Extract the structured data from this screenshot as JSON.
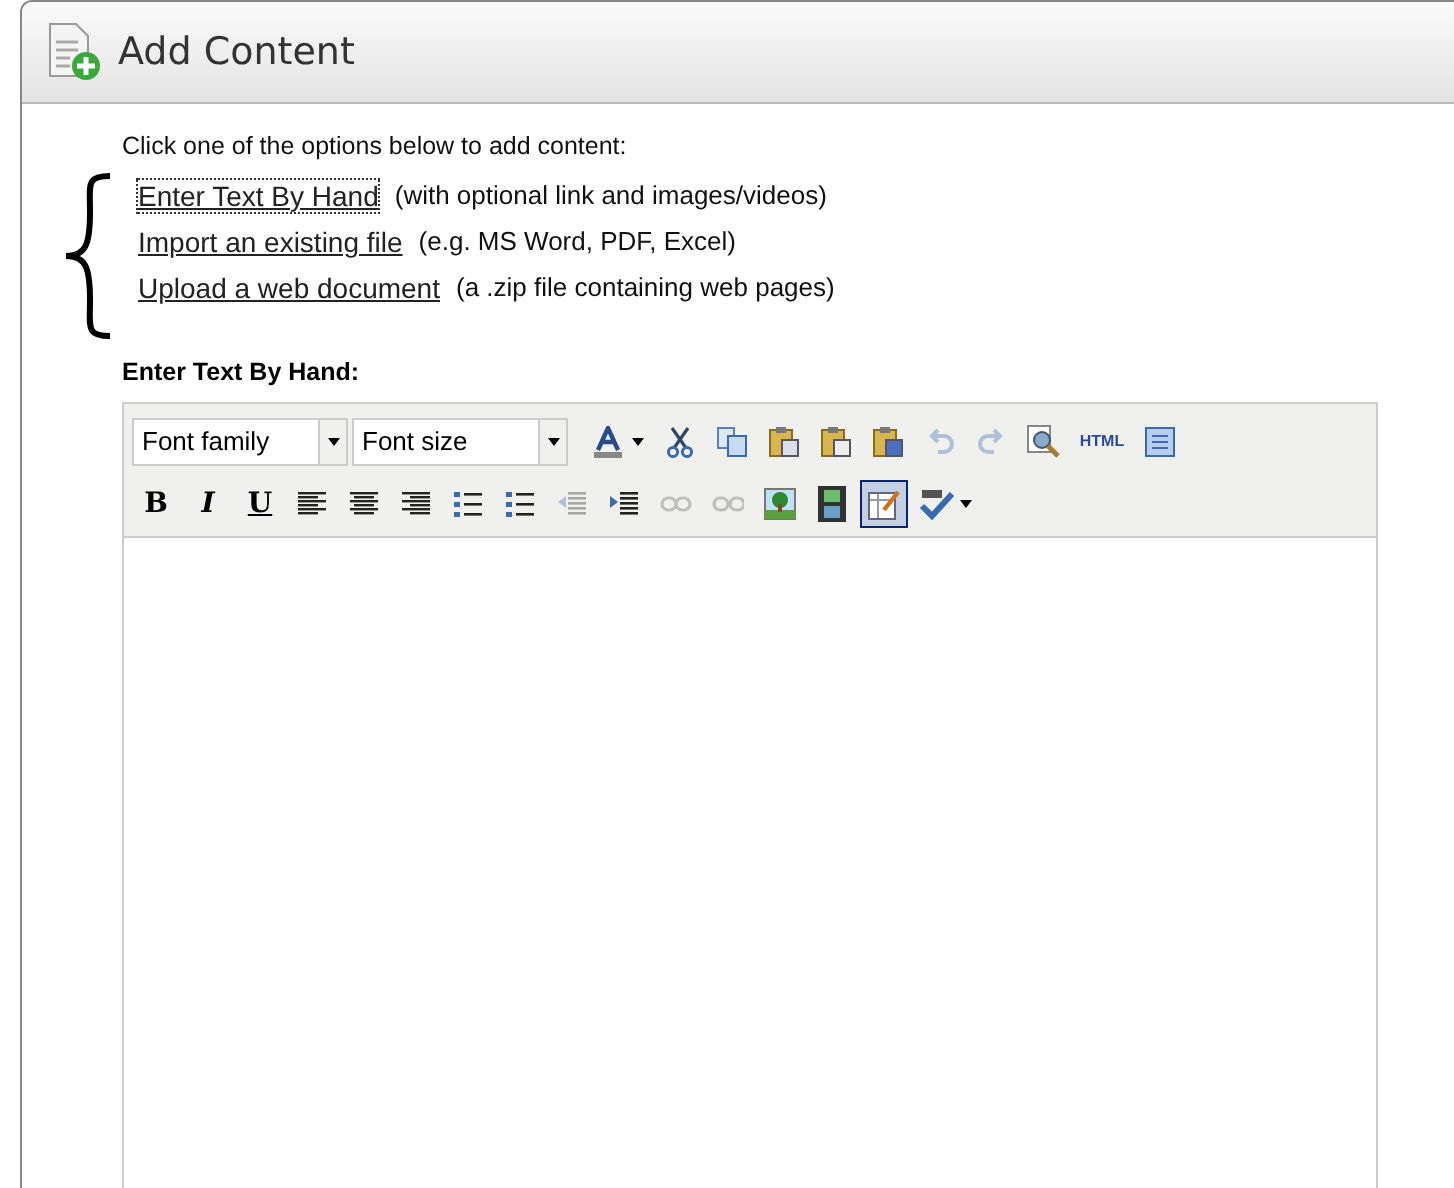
{
  "panel": {
    "title": "Add Content"
  },
  "intro": "Click one of the options below to add content:",
  "options": [
    {
      "link": "Enter Text By Hand",
      "note": "(with optional link and images/videos)",
      "focused": true
    },
    {
      "link": "Import an existing file",
      "note": "(e.g. MS Word, PDF, Excel)",
      "focused": false
    },
    {
      "link": "Upload a web document",
      "note": "(a .zip file containing web pages)",
      "focused": false
    }
  ],
  "editor_label": "Enter Text By Hand:",
  "editor": {
    "selects": [
      {
        "placeholder": "Font family"
      },
      {
        "placeholder": "Font size"
      }
    ],
    "row1": [
      {
        "kind": "textcolor",
        "disabled": false,
        "selected": false
      },
      {
        "kind": "cut",
        "disabled": false,
        "selected": false
      },
      {
        "kind": "copy",
        "disabled": false,
        "selected": false
      },
      {
        "kind": "paste",
        "disabled": false,
        "selected": false
      },
      {
        "kind": "pastetext",
        "disabled": false,
        "selected": false
      },
      {
        "kind": "pasteword",
        "disabled": false,
        "selected": false
      },
      {
        "kind": "undo",
        "disabled": true,
        "selected": false
      },
      {
        "kind": "redo",
        "disabled": true,
        "selected": false
      },
      {
        "kind": "preview",
        "disabled": false,
        "selected": false
      },
      {
        "kind": "text",
        "label": "HTML",
        "disabled": false,
        "selected": false
      },
      {
        "kind": "fullscreen",
        "disabled": false,
        "selected": false
      }
    ],
    "row2": [
      {
        "kind": "bold",
        "label": "B",
        "disabled": false,
        "selected": false
      },
      {
        "kind": "italic",
        "label": "I",
        "disabled": false,
        "selected": false
      },
      {
        "kind": "underline",
        "label": "U",
        "disabled": false,
        "selected": false
      },
      {
        "kind": "alignleft",
        "disabled": false,
        "selected": false
      },
      {
        "kind": "aligncenter",
        "disabled": false,
        "selected": false
      },
      {
        "kind": "alignright",
        "disabled": false,
        "selected": false
      },
      {
        "kind": "numlist",
        "disabled": false,
        "selected": false
      },
      {
        "kind": "bullist",
        "disabled": false,
        "selected": false
      },
      {
        "kind": "outdent",
        "disabled": true,
        "selected": false
      },
      {
        "kind": "indent",
        "disabled": false,
        "selected": false
      },
      {
        "kind": "link",
        "disabled": true,
        "selected": false
      },
      {
        "kind": "unlink",
        "disabled": true,
        "selected": false
      },
      {
        "kind": "image",
        "disabled": false,
        "selected": false
      },
      {
        "kind": "media",
        "disabled": false,
        "selected": false
      },
      {
        "kind": "tableedit",
        "disabled": false,
        "selected": true
      },
      {
        "kind": "spellcheck",
        "disabled": false
      }
    ]
  }
}
